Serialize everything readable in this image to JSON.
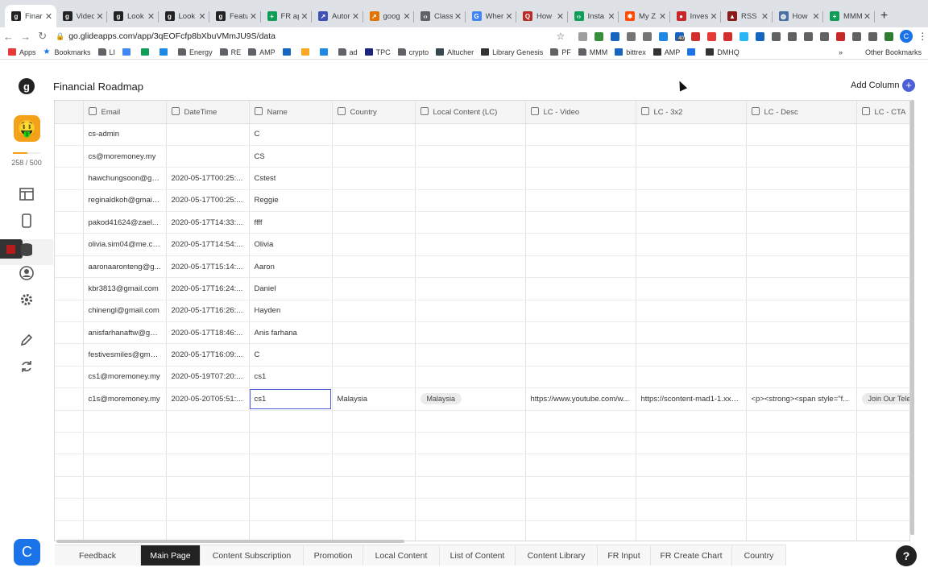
{
  "browser": {
    "tabs": [
      {
        "title": "Finar",
        "icon": "glide-icon",
        "color": "#222222",
        "glyph": "g",
        "active": true
      },
      {
        "title": "Video",
        "icon": "glide-icon",
        "color": "#222222",
        "glyph": "g"
      },
      {
        "title": "Look",
        "icon": "glide-icon",
        "color": "#222222",
        "glyph": "g"
      },
      {
        "title": "Look",
        "icon": "glide-icon",
        "color": "#222222",
        "glyph": "g"
      },
      {
        "title": "Featu",
        "icon": "glide-icon",
        "color": "#222222",
        "glyph": "g"
      },
      {
        "title": "FR ap",
        "icon": "sheets-icon",
        "color": "#0f9d58",
        "glyph": "+"
      },
      {
        "title": "Autor",
        "icon": "chart-icon",
        "color": "#3f51b5",
        "glyph": "↗"
      },
      {
        "title": "goog",
        "icon": "chart-icon",
        "color": "#e37400",
        "glyph": "↗"
      },
      {
        "title": "Class",
        "icon": "code-icon",
        "color": "#5f6368",
        "glyph": "‹›"
      },
      {
        "title": "Wher",
        "icon": "google-icon",
        "color": "#4285f4",
        "glyph": "G"
      },
      {
        "title": "How",
        "icon": "quora-icon",
        "color": "#b92b27",
        "glyph": "Q"
      },
      {
        "title": "Insta",
        "icon": "code-icon",
        "color": "#0f9d58",
        "glyph": "‹›"
      },
      {
        "title": "My Z",
        "icon": "zapier-icon",
        "color": "#ff4a00",
        "glyph": "✱"
      },
      {
        "title": "Inves",
        "icon": "pin-icon",
        "color": "#c62828",
        "glyph": "●"
      },
      {
        "title": "RSS",
        "icon": "rss-icon",
        "color": "#8b1a1a",
        "glyph": "▲"
      },
      {
        "title": "How",
        "icon": "globe-icon",
        "color": "#4a6fa5",
        "glyph": "◍"
      },
      {
        "title": "MMM",
        "icon": "sheets-icon",
        "color": "#0f9d58",
        "glyph": "+"
      }
    ],
    "url": "go.glideapps.com/app/3qEOFcfp8bXbuVMmJU9S/data",
    "extensions": [
      "#9e9e9e",
      "#388e3c",
      "#1565c0",
      "#757575",
      "#757575",
      "#1e88e5",
      "#1565c0",
      "#d32f2f",
      "#e53935",
      "#d32f2f",
      "#29b6f6",
      "#1565c0",
      "#616161",
      "#616161",
      "#616161",
      "#616161",
      "#c62828",
      "#616161",
      "#616161",
      "#2e7d32"
    ],
    "extension_badge": "40",
    "profile_initial": "C",
    "bookmarks": [
      {
        "label": "Apps",
        "icon": "apps-icon",
        "color": "#e53935"
      },
      {
        "label": "Bookmarks",
        "icon": "star-icon",
        "color": "#1a73e8"
      },
      {
        "label": "LI",
        "icon": "folder-icon",
        "color": "#5f6368"
      },
      {
        "label": "",
        "icon": "docs-icon",
        "color": "#4285f4"
      },
      {
        "label": "",
        "icon": "sheets-icon",
        "color": "#0f9d58"
      },
      {
        "label": "",
        "icon": "circle-icon",
        "color": "#1e88e5"
      },
      {
        "label": "Energy",
        "icon": "folder-icon",
        "color": "#5f6368"
      },
      {
        "label": "RE",
        "icon": "folder-icon",
        "color": "#5f6368"
      },
      {
        "label": "AMP",
        "icon": "folder-icon",
        "color": "#5f6368"
      },
      {
        "label": "",
        "icon": "bank-icon",
        "color": "#1565c0"
      },
      {
        "label": "",
        "icon": "logo-icon",
        "color": "#f9a825"
      },
      {
        "label": "",
        "icon": "mail-icon",
        "color": "#1e88e5"
      },
      {
        "label": "ad",
        "icon": "folder-icon",
        "color": "#5f6368"
      },
      {
        "label": "TPC",
        "icon": "tpc-icon",
        "color": "#1a237e"
      },
      {
        "label": "crypto",
        "icon": "folder-icon",
        "color": "#5f6368"
      },
      {
        "label": "Altucher",
        "icon": "check-icon",
        "color": "#37474f"
      },
      {
        "label": "Library Genesis",
        "icon": "book-icon",
        "color": "#333333"
      },
      {
        "label": "PF",
        "icon": "folder-icon",
        "color": "#5f6368"
      },
      {
        "label": "MMM",
        "icon": "folder-icon",
        "color": "#5f6368"
      },
      {
        "label": "bittrex",
        "icon": "bittrex-icon",
        "color": "#1565c0"
      },
      {
        "label": "AMP",
        "icon": "globe-icon",
        "color": "#333333"
      },
      {
        "label": "",
        "icon": "c-icon",
        "color": "#1a73e8"
      },
      {
        "label": "DMHQ",
        "icon": "dmhq-icon",
        "color": "#333333"
      }
    ],
    "bookmarks_overflow": "»",
    "other_bookmarks": "Other Bookmarks"
  },
  "rail": {
    "logo": "g",
    "app_emoji": "🤑",
    "usage_text": "258 / 500",
    "usage_fraction": 0.516,
    "bottom_initial": "C"
  },
  "header": {
    "title": "Financial Roadmap",
    "add_column": "Add Column"
  },
  "grid": {
    "columns": [
      {
        "label": "",
        "icon": "",
        "width": 35
      },
      {
        "label": "Email",
        "icon": "email-icon",
        "width": 103
      },
      {
        "label": "DateTime",
        "icon": "calendar-icon",
        "width": 103
      },
      {
        "label": "Name",
        "icon": "text-icon",
        "width": 103
      },
      {
        "label": "Country",
        "icon": "text-icon",
        "width": 103
      },
      {
        "label": "Local Content (LC)",
        "icon": "relation-icon",
        "width": 137
      },
      {
        "label": "LC - Video",
        "icon": "image-icon",
        "width": 137
      },
      {
        "label": "LC - 3x2",
        "icon": "image-icon",
        "width": 137
      },
      {
        "label": "LC - Desc",
        "icon": "image-icon",
        "width": 137
      },
      {
        "label": "LC - CTA",
        "icon": "image-icon",
        "width": 70
      }
    ],
    "rows": [
      [
        "",
        "cs-admin",
        "",
        "C",
        "",
        "",
        "",
        "",
        "",
        ""
      ],
      [
        "",
        "cs@moremoney.my",
        "",
        "CS",
        "",
        "",
        "",
        "",
        "",
        ""
      ],
      [
        "",
        "hawchungsoon@gm...",
        "2020-05-17T00:25:...",
        "Cstest",
        "",
        "",
        "",
        "",
        "",
        ""
      ],
      [
        "",
        "reginaldkoh@gmail....",
        "2020-05-17T00:25:...",
        "Reggie",
        "",
        "",
        "",
        "",
        "",
        ""
      ],
      [
        "",
        "pakod41624@zael...",
        "2020-05-17T14:33:...",
        "ffff",
        "",
        "",
        "",
        "",
        "",
        ""
      ],
      [
        "",
        "olivia.sim04@me.com",
        "2020-05-17T14:54:...",
        "Olivia",
        "",
        "",
        "",
        "",
        "",
        ""
      ],
      [
        "",
        "aaronaaronteng@g...",
        "2020-05-17T15:14:...",
        "Aaron",
        "",
        "",
        "",
        "",
        "",
        ""
      ],
      [
        "",
        "kbr3813@gmail.com",
        "2020-05-17T16:24:...",
        "Daniel",
        "",
        "",
        "",
        "",
        "",
        ""
      ],
      [
        "",
        "chinengl@gmail.com",
        "2020-05-17T16:26:...",
        "Hayden",
        "",
        "",
        "",
        "",
        "",
        ""
      ],
      [
        "",
        "anisfarhanaftw@gm...",
        "2020-05-17T18:46:...",
        "Anis farhana",
        "",
        "",
        "",
        "",
        "",
        ""
      ],
      [
        "",
        "festivesmiles@gmai...",
        "2020-05-17T16:09:...",
        "C",
        "",
        "",
        "",
        "",
        "",
        ""
      ],
      [
        "",
        "cs1@moremoney.my",
        "2020-05-19T07:20:...",
        "cs1",
        "",
        "",
        "",
        "",
        "",
        ""
      ],
      [
        "",
        "c1s@moremoney.my",
        "2020-05-20T05:51:...",
        "cs1",
        "Malaysia",
        "Malaysia",
        "https://www.youtube.com/w...",
        "https://scontent-mad1-1.xx.f...",
        "<p><strong><span style=\"f...",
        "Join Our Tele"
      ],
      [
        "",
        "",
        "",
        "",
        "",
        "",
        "",
        "",
        "",
        ""
      ],
      [
        "",
        "",
        "",
        "",
        "",
        "",
        "",
        "",
        "",
        ""
      ],
      [
        "",
        "",
        "",
        "",
        "",
        "",
        "",
        "",
        "",
        ""
      ],
      [
        "",
        "",
        "",
        "",
        "",
        "",
        "",
        "",
        "",
        ""
      ],
      [
        "",
        "",
        "",
        "",
        "",
        "",
        "",
        "",
        "",
        ""
      ],
      [
        "",
        "",
        "",
        "",
        "",
        "",
        "",
        "",
        "",
        ""
      ]
    ],
    "selected_cell": [
      12,
      3
    ],
    "chip_cells": [
      [
        12,
        5
      ],
      [
        12,
        9
      ]
    ]
  },
  "sheet_tabs": [
    {
      "label": "Feedback",
      "width": 107
    },
    {
      "label": "Main Page",
      "width": 74,
      "active": true
    },
    {
      "label": "Content Subscription",
      "width": 128
    },
    {
      "label": "Promotion",
      "width": 74
    },
    {
      "label": "Local Content",
      "width": 95
    },
    {
      "label": "List of Content",
      "width": 94
    },
    {
      "label": "Content Library",
      "width": 102
    },
    {
      "label": "FR Input",
      "width": 66
    },
    {
      "label": "FR Create Chart",
      "width": 101
    },
    {
      "label": "Country",
      "width": 67
    }
  ],
  "help_label": "?"
}
